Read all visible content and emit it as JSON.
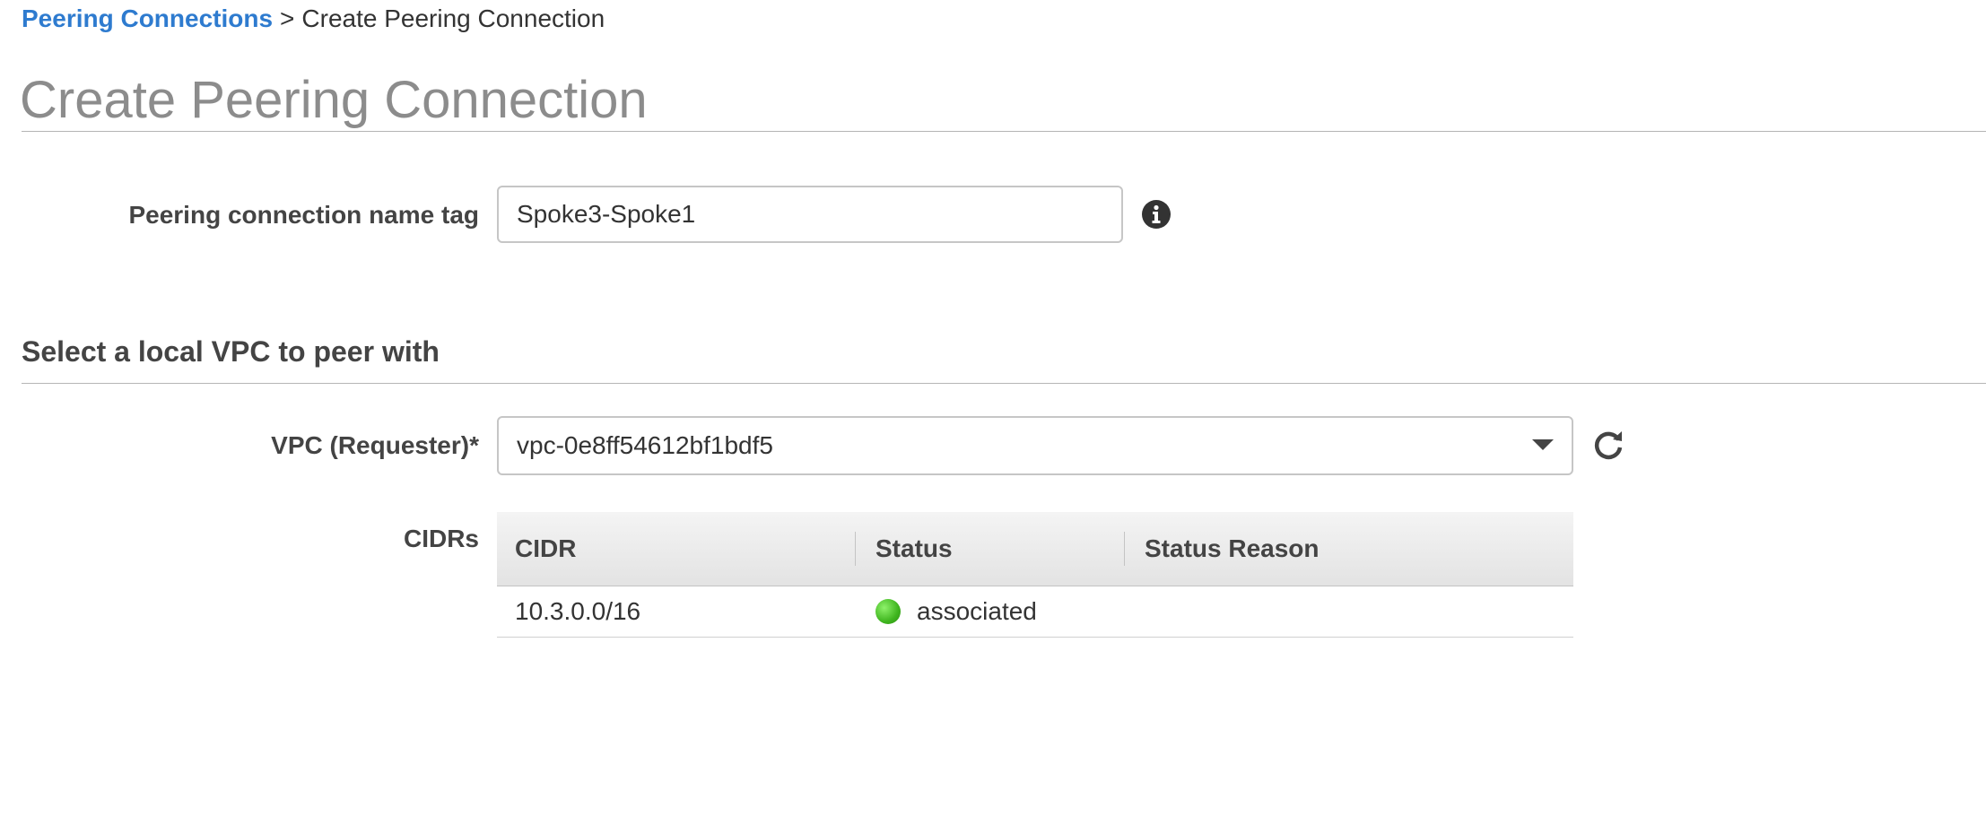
{
  "breadcrumb": {
    "parent": "Peering Connections",
    "separator": ">",
    "current": "Create Peering Connection"
  },
  "page": {
    "title": "Create Peering Connection"
  },
  "name_tag": {
    "label": "Peering connection name tag",
    "value": "Spoke3-Spoke1",
    "info_icon": "info-circle-icon"
  },
  "local_vpc": {
    "section_title": "Select a local VPC to peer with",
    "vpc_label": "VPC (Requester)*",
    "vpc_value": "vpc-0e8ff54612bf1bdf5",
    "refresh_icon": "refresh-icon"
  },
  "cidrs": {
    "label": "CIDRs",
    "columns": [
      "CIDR",
      "Status",
      "Status Reason"
    ],
    "rows": [
      {
        "cidr": "10.3.0.0/16",
        "status": "associated",
        "status_reason": "",
        "status_color": "#3fb51f"
      }
    ]
  },
  "colors": {
    "link": "#2e7bcf",
    "title_gray": "#8c8c8c",
    "status_ok": "#3fb51f"
  }
}
